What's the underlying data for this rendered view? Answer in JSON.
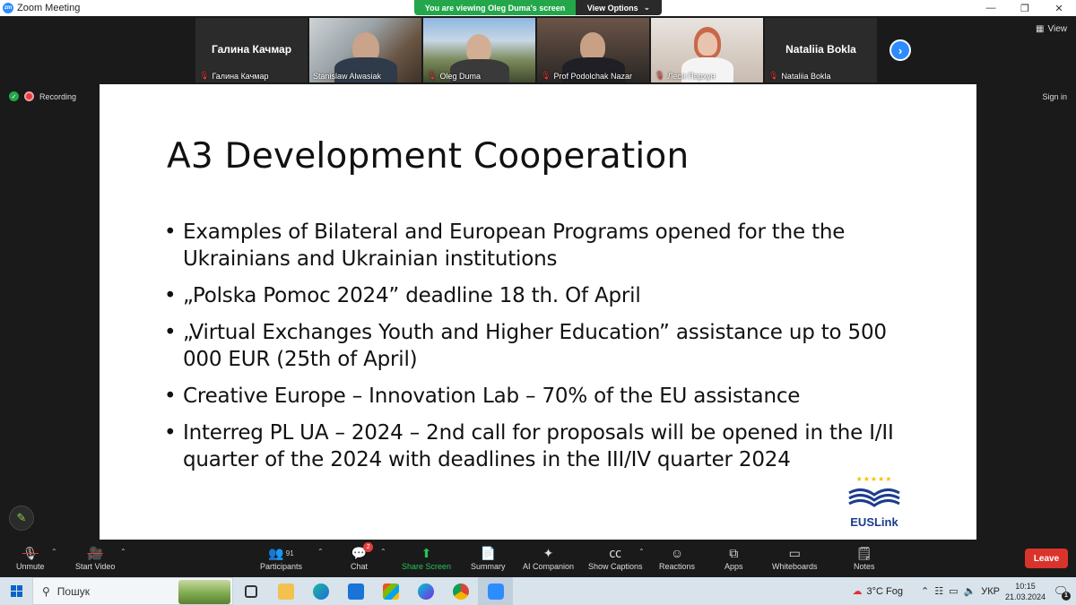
{
  "window": {
    "title": "Zoom Meeting",
    "app_icon": "zm",
    "minimize": "—",
    "restore": "❐",
    "close": "✕"
  },
  "banner": {
    "message": "You are viewing Oleg Duma's screen",
    "options_label": "View Options",
    "options_caret": "⌄"
  },
  "participants": [
    {
      "display_name": "Галина Качмар",
      "label": "Галина Качмар",
      "video": false,
      "muted": true
    },
    {
      "display_name": "",
      "label": "Stanislaw Alwasiak",
      "video": true,
      "muted": false,
      "active": true
    },
    {
      "display_name": "",
      "label": "Oleg Duma",
      "video": true,
      "muted": true
    },
    {
      "display_name": "",
      "label": "Prof Podolchak Nazar",
      "video": true,
      "muted": true
    },
    {
      "display_name": "",
      "label": "Леся Перхун",
      "video": true,
      "muted": true
    },
    {
      "display_name": "Nataliia Bokla",
      "label": "Nataliia Bokla",
      "video": false,
      "muted": true
    }
  ],
  "next_label": "›",
  "view_label": "View",
  "status": {
    "recording": "Recording",
    "sign_in": "Sign in"
  },
  "slide": {
    "title": "A3 Development Cooperation",
    "bullets": [
      "Examples of Bilateral and European Programs opened for the the Ukrainians and Ukrainian institutions",
      "„Polska Pomoc 2024” deadline 18 th. Of April",
      "„Virtual Exchanges Youth and Higher Education” assistance up to 500 000 EUR (25th of April)",
      "Creative Europe – Innovation Lab  – 70% of the EU assistance",
      "Interreg PL UA – 2024 – 2nd call for proposals will be opened in the I/II quarter of the 2024 with deadlines in the III/IV quarter 2024"
    ],
    "logo_stars": "★★★★★",
    "logo_text": "EUSLink"
  },
  "toolbar": {
    "unmute": "Unmute",
    "start_video": "Start Video",
    "participants": "Participants",
    "participants_count": "91",
    "chat": "Chat",
    "chat_badge": "2",
    "share_screen": "Share Screen",
    "summary": "Summary",
    "ai_companion": "AI Companion",
    "show_captions": "Show Captions",
    "reactions": "Reactions",
    "apps": "Apps",
    "whiteboards": "Whiteboards",
    "notes": "Notes",
    "leave": "Leave"
  },
  "taskbar": {
    "search_placeholder": "Пошук",
    "weather": "3°C  Fog",
    "language": "УКР",
    "time": "10:15",
    "date": "21.03.2024",
    "notification_count": "1"
  },
  "colors": {
    "zoom_blue": "#2d8cff",
    "banner_green": "#23a74a",
    "leave_red": "#d9342b",
    "active_outline": "#8fd14f"
  }
}
